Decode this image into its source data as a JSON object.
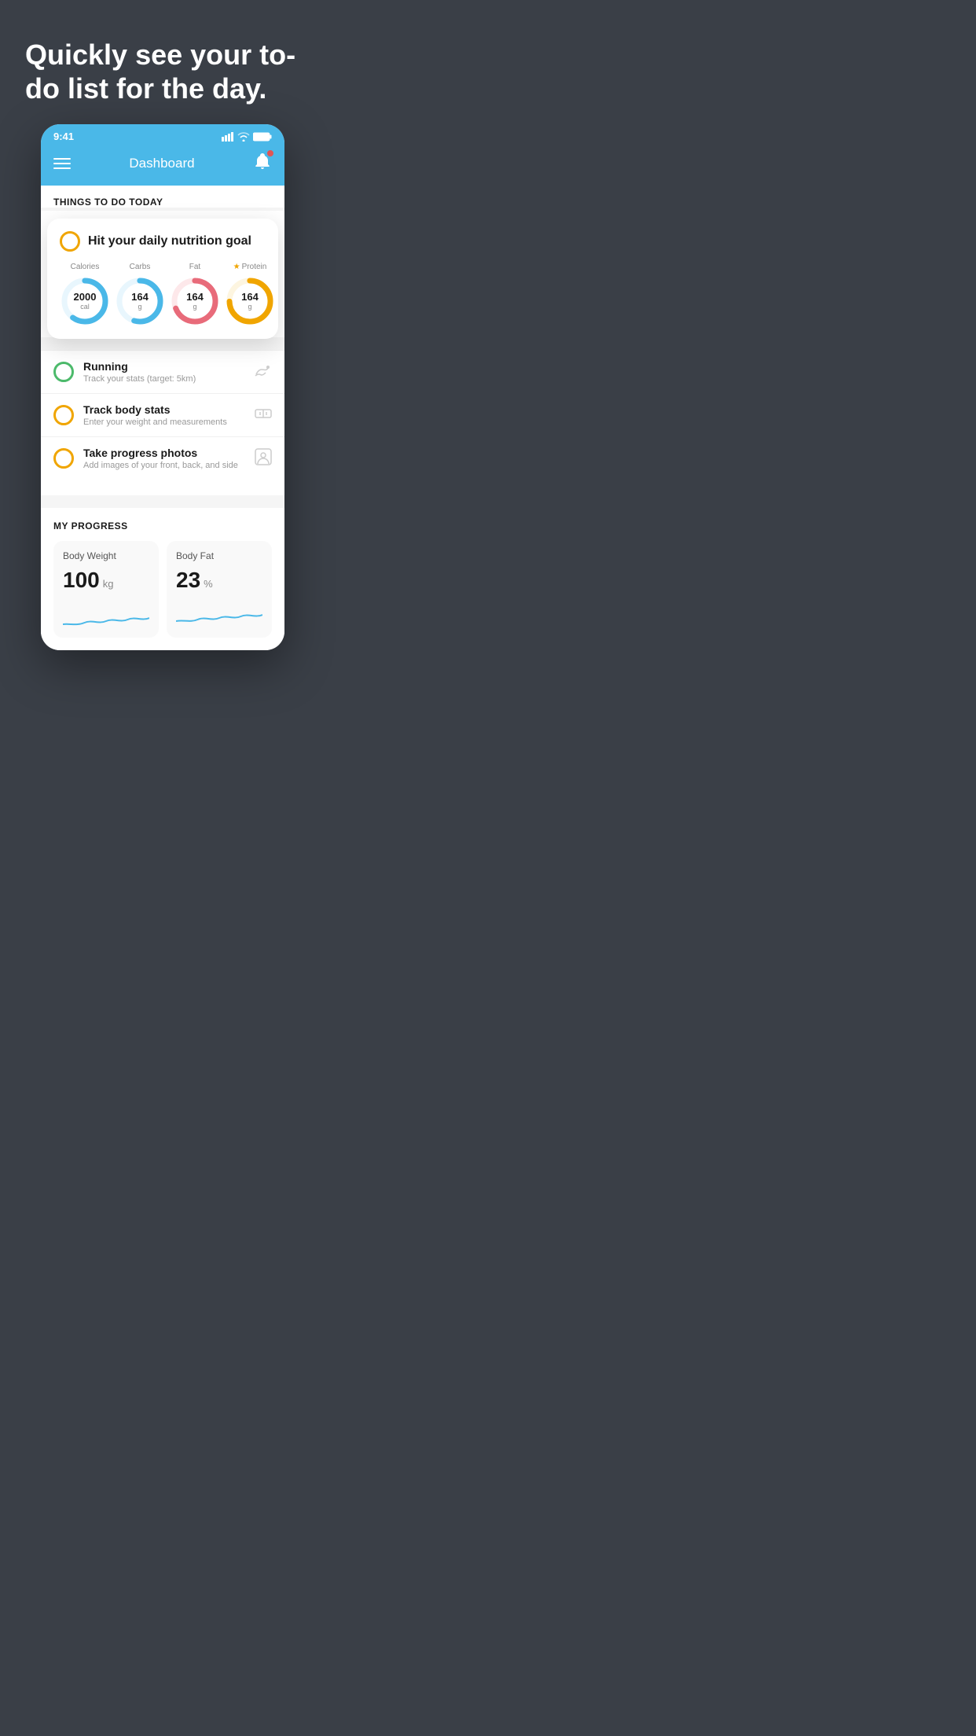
{
  "hero": {
    "title": "Quickly see your to-do list for the day."
  },
  "status_bar": {
    "time": "9:41",
    "signal": "●●●●",
    "wifi": "wifi",
    "battery": "battery"
  },
  "header": {
    "title": "Dashboard"
  },
  "things_section": {
    "title": "THINGS TO DO TODAY"
  },
  "nutrition_card": {
    "title": "Hit your daily nutrition goal",
    "items": [
      {
        "label": "Calories",
        "value": "2000",
        "unit": "cal",
        "color": "#4ab8e8",
        "bg": "#e8f6fd",
        "percent": 60
      },
      {
        "label": "Carbs",
        "value": "164",
        "unit": "g",
        "color": "#4ab8e8",
        "bg": "#e8f6fd",
        "percent": 55
      },
      {
        "label": "Fat",
        "value": "164",
        "unit": "g",
        "color": "#e86b7a",
        "bg": "#fde8ea",
        "percent": 70
      },
      {
        "label": "Protein",
        "value": "164",
        "unit": "g",
        "color": "#f0a500",
        "bg": "#fdf5e0",
        "percent": 75,
        "star": true
      }
    ]
  },
  "todo_items": [
    {
      "id": "running",
      "title": "Running",
      "subtitle": "Track your stats (target: 5km)",
      "icon": "👟",
      "checked": true,
      "check_color": "#4cba6b"
    },
    {
      "id": "body-stats",
      "title": "Track body stats",
      "subtitle": "Enter your weight and measurements",
      "icon": "⚖️",
      "checked": false,
      "check_color": "#f0a500"
    },
    {
      "id": "progress-photos",
      "title": "Take progress photos",
      "subtitle": "Add images of your front, back, and side",
      "icon": "👤",
      "checked": false,
      "check_color": "#f0a500"
    }
  ],
  "progress": {
    "title": "MY PROGRESS",
    "cards": [
      {
        "title": "Body Weight",
        "value": "100",
        "unit": "kg"
      },
      {
        "title": "Body Fat",
        "value": "23",
        "unit": "%"
      }
    ]
  }
}
